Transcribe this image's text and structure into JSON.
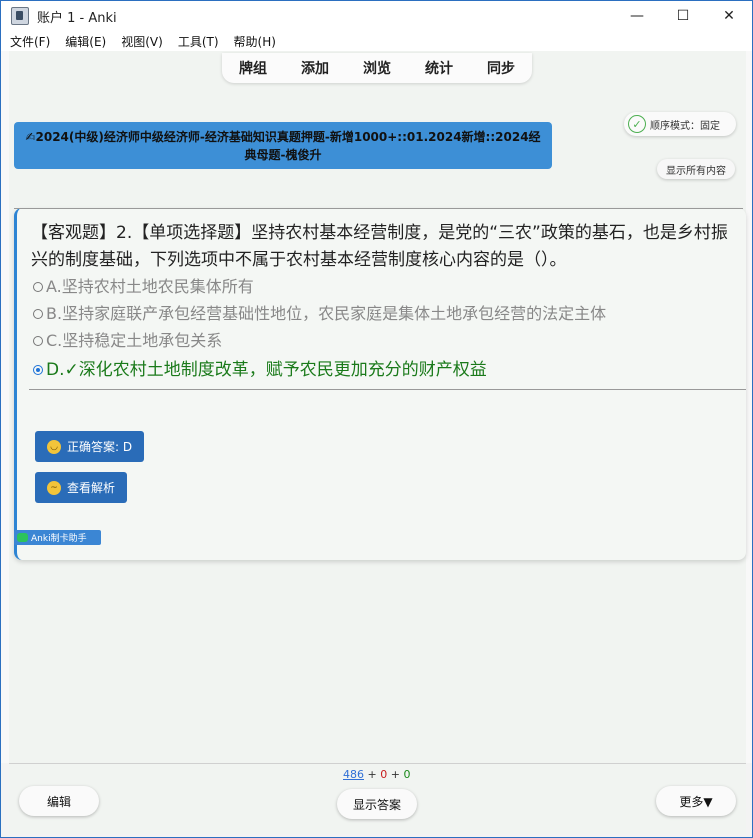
{
  "window": {
    "title": "账户 1 - Anki",
    "minimize": "—",
    "maximize": "☐",
    "close": "✕"
  },
  "menu": [
    "文件(F)",
    "编辑(E)",
    "视图(V)",
    "工具(T)",
    "帮助(H)"
  ],
  "toolbar": {
    "tabs": [
      "牌组",
      "添加",
      "浏览",
      "统计",
      "同步"
    ]
  },
  "deck": {
    "title": "✍2024(中级)经济师中级经济师-经济基础知识真题押题-新增1000+::01.2024新增::2024经典母题-槐俊升"
  },
  "mode": {
    "label": "顺序模式：固定",
    "icon": "check-circle-icon"
  },
  "show_all_label": "显示所有内容",
  "card": {
    "question": "【客观题】2.【单项选择题】坚持农村基本经营制度，是党的“三农”政策的基石，也是乡村振兴的制度基础，下列选项中不属于农村基本经营制度核心内容的是（）。",
    "options": [
      {
        "text": "A.坚持农村土地农民集体所有",
        "correct": false
      },
      {
        "text": "B.坚持家庭联产承包经营基础性地位，农民家庭是集体土地承包经营的法定主体",
        "correct": false
      },
      {
        "text": "C.坚持稳定土地承包关系",
        "correct": false
      },
      {
        "text": "D.✓深化农村土地制度改革，赋予农民更加充分的财产权益",
        "correct": true
      }
    ],
    "answer_button": "正确答案: D",
    "analysis_button": "查看解析",
    "colors": {
      "accent": "#2d84d3",
      "correct": "#1a7a1a",
      "button": "#2a6cb8"
    }
  },
  "helper_badge": "Anki制卡助手",
  "bottom": {
    "count_new": "486",
    "count_learn": "0",
    "count_review": "0",
    "edit_label": "编辑",
    "show_answer_label": "显示答案",
    "more_label": "更多▼"
  }
}
